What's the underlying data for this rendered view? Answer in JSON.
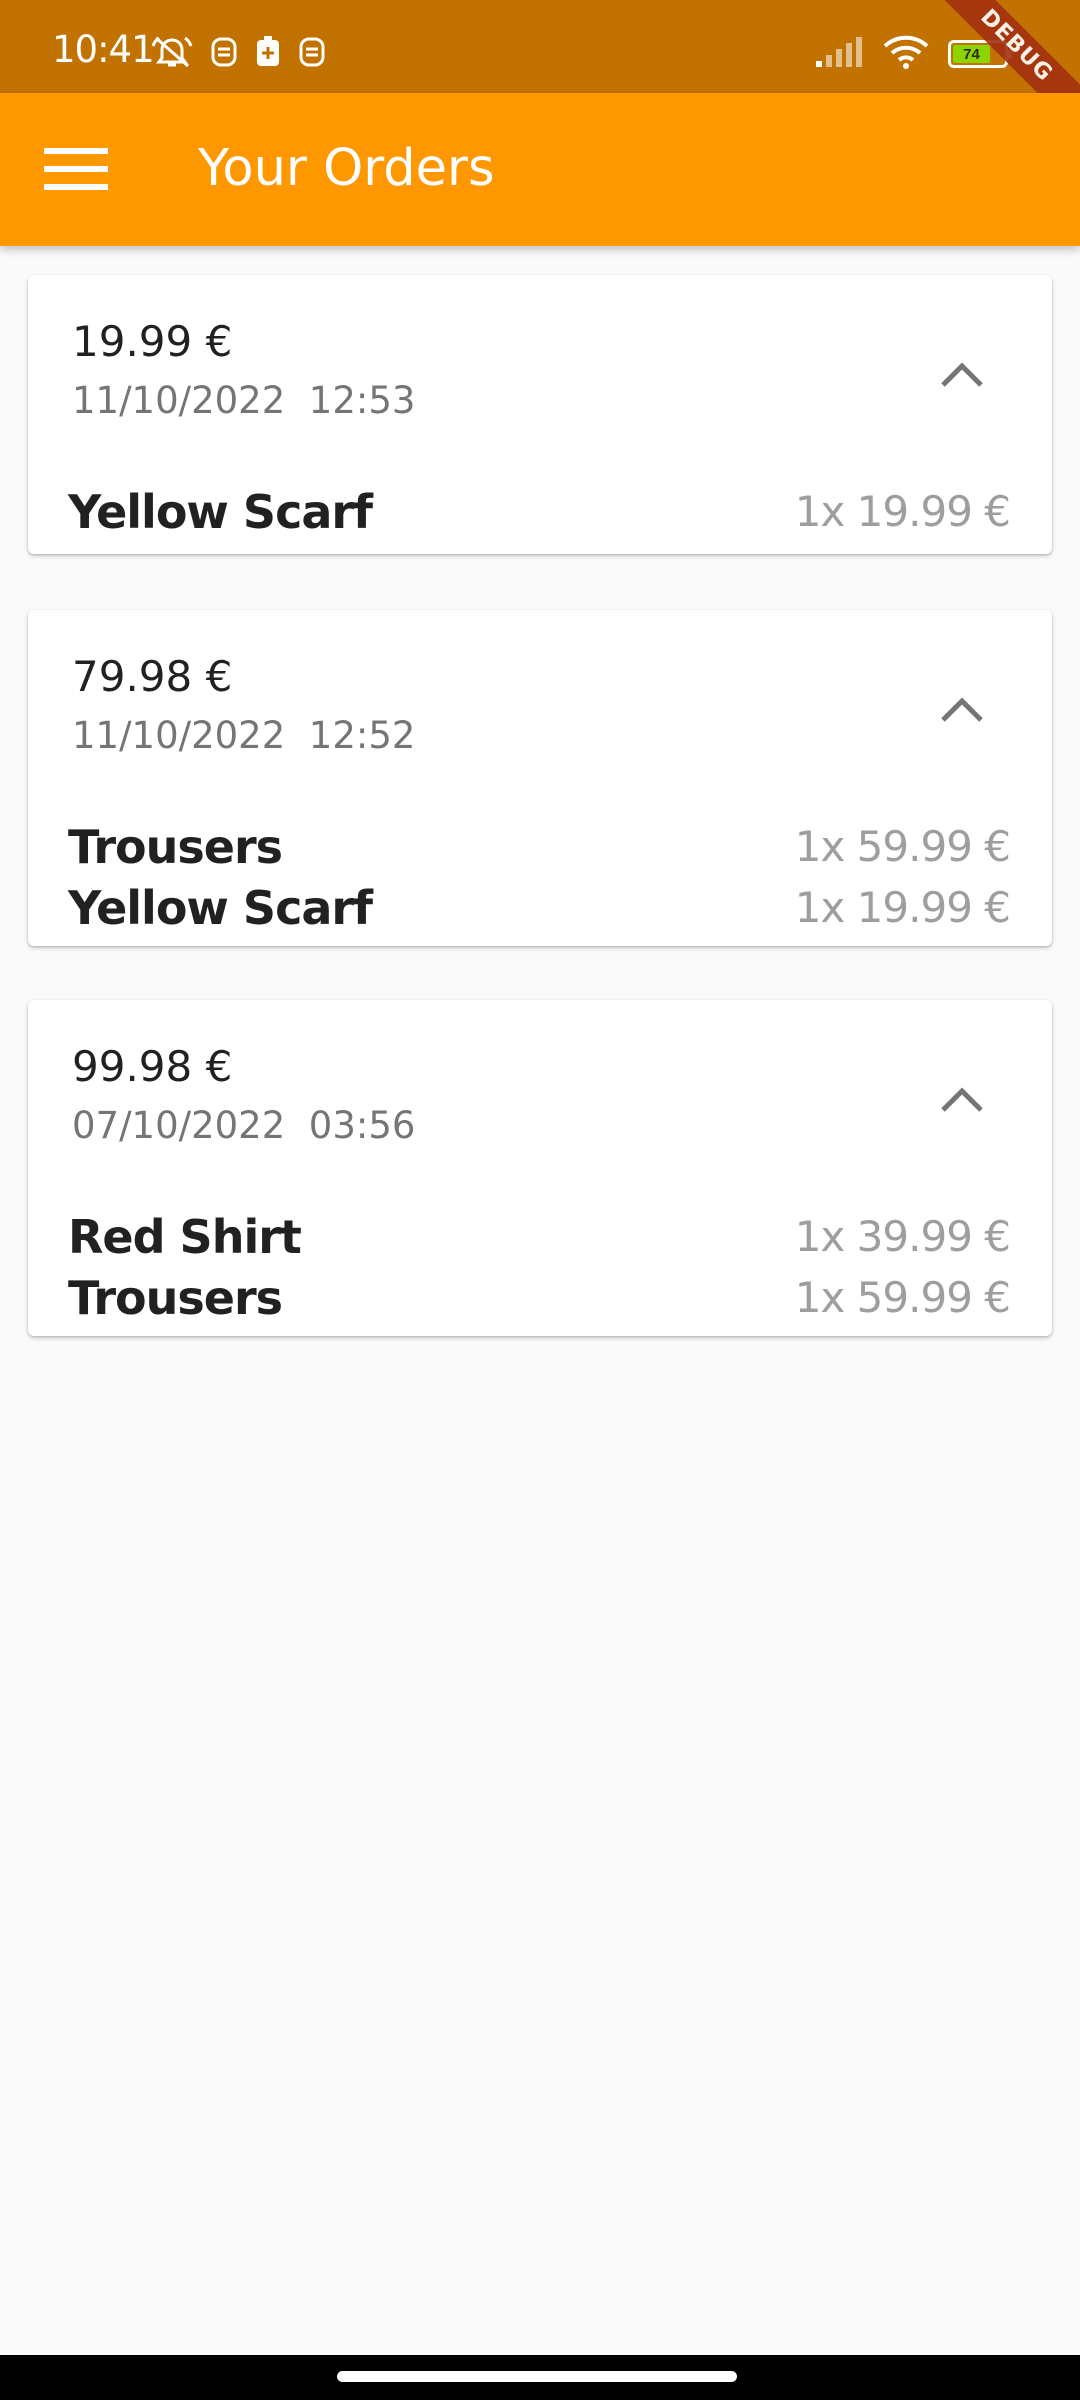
{
  "status_bar": {
    "time": "10:41",
    "battery_level": "74",
    "debug_label": "DEBUG",
    "icons": [
      "alarm-off-icon",
      "app-notification-icon",
      "battery-saver-icon",
      "app-notification-icon",
      "signal-icon",
      "wifi-icon",
      "battery-icon"
    ]
  },
  "app_bar": {
    "title": "Your Orders",
    "menu_icon": "menu-icon",
    "background_color": "#ff9800"
  },
  "orders": [
    {
      "total": "19.99 €",
      "date": "11/10/2022  12:53",
      "expanded": true,
      "items": [
        {
          "name": "Yellow Scarf",
          "qty_price": "1x 19.99 €"
        }
      ]
    },
    {
      "total": "79.98 €",
      "date": "11/10/2022  12:52",
      "expanded": true,
      "items": [
        {
          "name": "Trousers",
          "qty_price": "1x 59.99 €"
        },
        {
          "name": "Yellow Scarf",
          "qty_price": "1x 19.99 €"
        }
      ]
    },
    {
      "total": "99.98 €",
      "date": "07/10/2022  03:56",
      "expanded": true,
      "items": [
        {
          "name": "Red Shirt",
          "qty_price": "1x 39.99 €"
        },
        {
          "name": "Trousers",
          "qty_price": "1x 59.99 €"
        }
      ]
    }
  ]
}
